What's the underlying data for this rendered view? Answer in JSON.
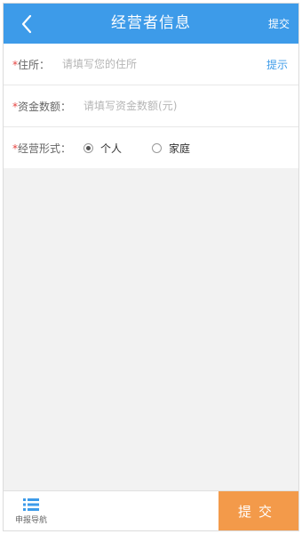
{
  "header": {
    "title": "经营者信息",
    "submit_label": "提交",
    "back_icon": "chevron-left-icon",
    "bg_color": "#3d9be9"
  },
  "form": {
    "address": {
      "label": "住所：",
      "placeholder": "请填写您的住所",
      "value": "",
      "hint_label": "提示"
    },
    "capital": {
      "label": "资金数额：",
      "placeholder": "请填写资金数额(元)",
      "value": ""
    },
    "business_form": {
      "label": "经营形式：",
      "options": [
        {
          "label": "个人",
          "selected": true
        },
        {
          "label": "家庭",
          "selected": false
        }
      ]
    }
  },
  "bottom_bar": {
    "nav_label": "申报导航",
    "nav_icon": "list-icon",
    "submit_label": "提交",
    "submit_color": "#f39a4a"
  }
}
